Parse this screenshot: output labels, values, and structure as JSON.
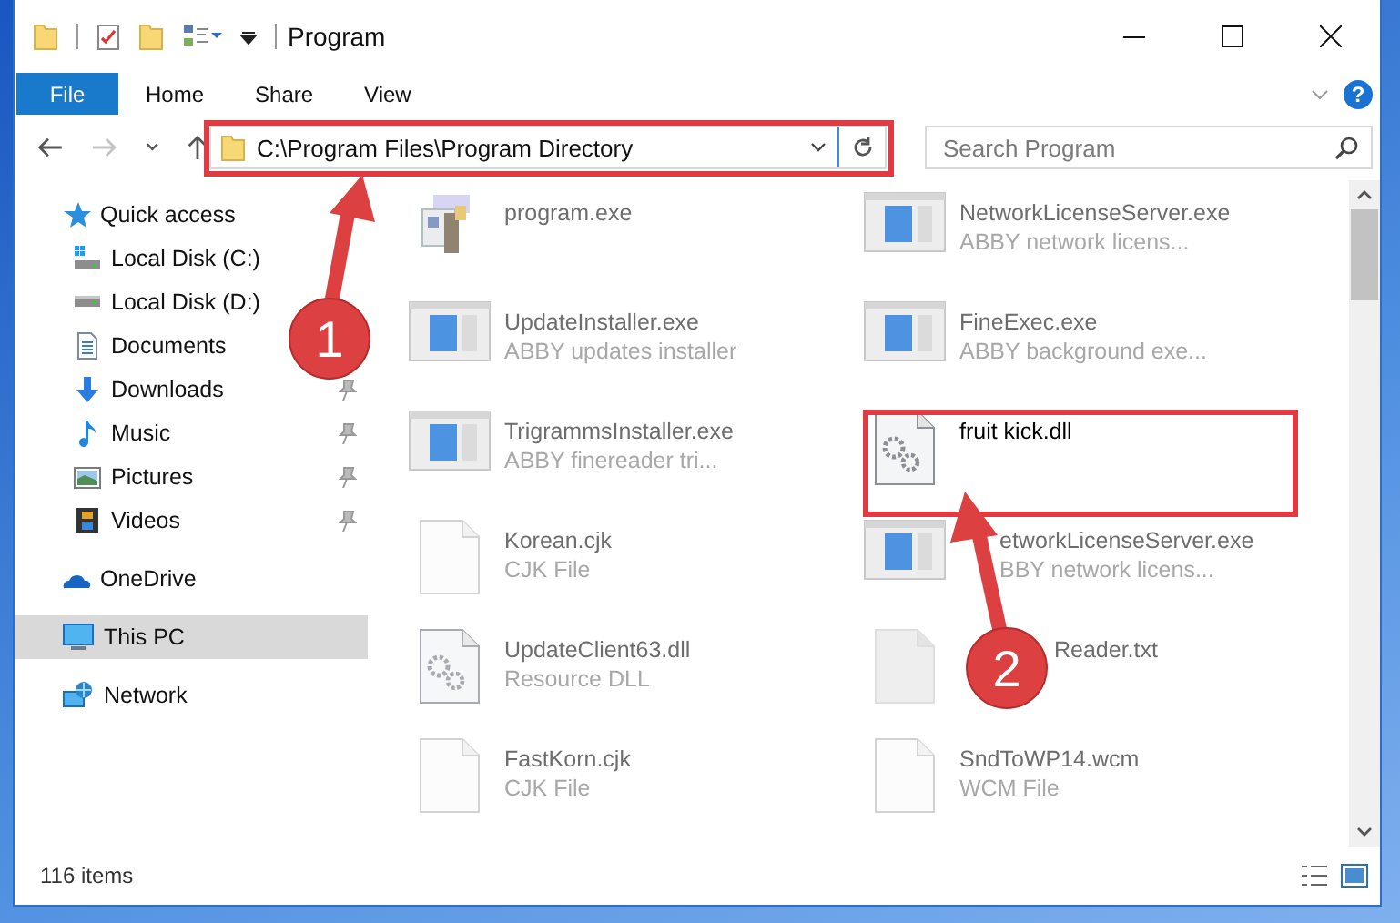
{
  "window": {
    "title": "Program"
  },
  "ribbon": {
    "tabs": [
      {
        "label": "File",
        "kind": "file"
      },
      {
        "label": "Home",
        "kind": "tab"
      },
      {
        "label": "Share",
        "kind": "tab"
      },
      {
        "label": "View",
        "kind": "tab"
      }
    ],
    "help": "?"
  },
  "navigation": [
    {
      "kind": "back",
      "disabled": false
    },
    {
      "kind": "forward",
      "disabled": true
    },
    {
      "kind": "recent",
      "disabled": false
    },
    {
      "kind": "up",
      "disabled": false
    }
  ],
  "address": {
    "path": "C:\\Program Files\\Program Directory"
  },
  "search": {
    "placeholder": "Search Program"
  },
  "sidebar": {
    "items": [
      {
        "label": "Quick access",
        "kind": "star",
        "selected": false,
        "children": [
          {
            "label": "Local Disk (C:)",
            "kind": "drive-win",
            "selected": false
          },
          {
            "label": "Local Disk (D:)",
            "kind": "drive",
            "selected": false
          },
          {
            "label": "Documents",
            "kind": "document",
            "selected": false
          },
          {
            "label": "Downloads",
            "kind": "download",
            "selected": false,
            "pinned": true
          },
          {
            "label": "Music",
            "kind": "music",
            "selected": false,
            "pinned": true
          },
          {
            "label": "Pictures",
            "kind": "pictures",
            "selected": false,
            "pinned": true
          },
          {
            "label": "Videos",
            "kind": "videos",
            "selected": false,
            "pinned": true
          }
        ]
      },
      {
        "label": "OneDrive",
        "kind": "cloud",
        "selected": false
      },
      {
        "label": "This PC",
        "kind": "pc",
        "selected": true
      },
      {
        "label": "Network",
        "kind": "network",
        "selected": false
      }
    ]
  },
  "files": [
    {
      "name": "program.exe",
      "kind": "program",
      "blurred": true
    },
    {
      "name": "NetworkLicenseServer.exe",
      "description": "ABBY network licens...",
      "kind": "app",
      "blurred": true
    },
    {
      "name": "UpdateInstaller.exe",
      "description": "ABBY updates installer",
      "kind": "app",
      "blurred": true
    },
    {
      "name": "FineExec.exe",
      "description": "ABBY background exe...",
      "kind": "app",
      "blurred": true
    },
    {
      "name": "TrigrammsInstaller.exe",
      "description": "ABBY finereader tri...",
      "kind": "app",
      "blurred": true
    },
    {
      "name": "fruit kick.dll",
      "kind": "dll",
      "blurred": false
    },
    {
      "name": "Korean.cjk",
      "description": "CJK File",
      "kind": "blank",
      "blurred": true
    },
    {
      "name": "etworkLicenseServer.exe",
      "description": "BBY network licens...",
      "kind": "app",
      "blurred": true
    },
    {
      "name": "UpdateClient63.dll",
      "description": "Resource DLL",
      "kind": "dll",
      "blurred": true
    },
    {
      "name": "Reader.txt",
      "kind": "text",
      "blurred": true
    },
    {
      "name": "FastKorn.cjk",
      "description": "CJK File",
      "kind": "blank",
      "blurred": true
    },
    {
      "name": "SndToWP14.wcm",
      "description": "WCM File",
      "kind": "blank",
      "blurred": true
    }
  ],
  "status_bar": {
    "count": "116 items"
  },
  "annotations": {
    "badges": [
      {
        "number": "1"
      },
      {
        "number": "2"
      }
    ]
  }
}
